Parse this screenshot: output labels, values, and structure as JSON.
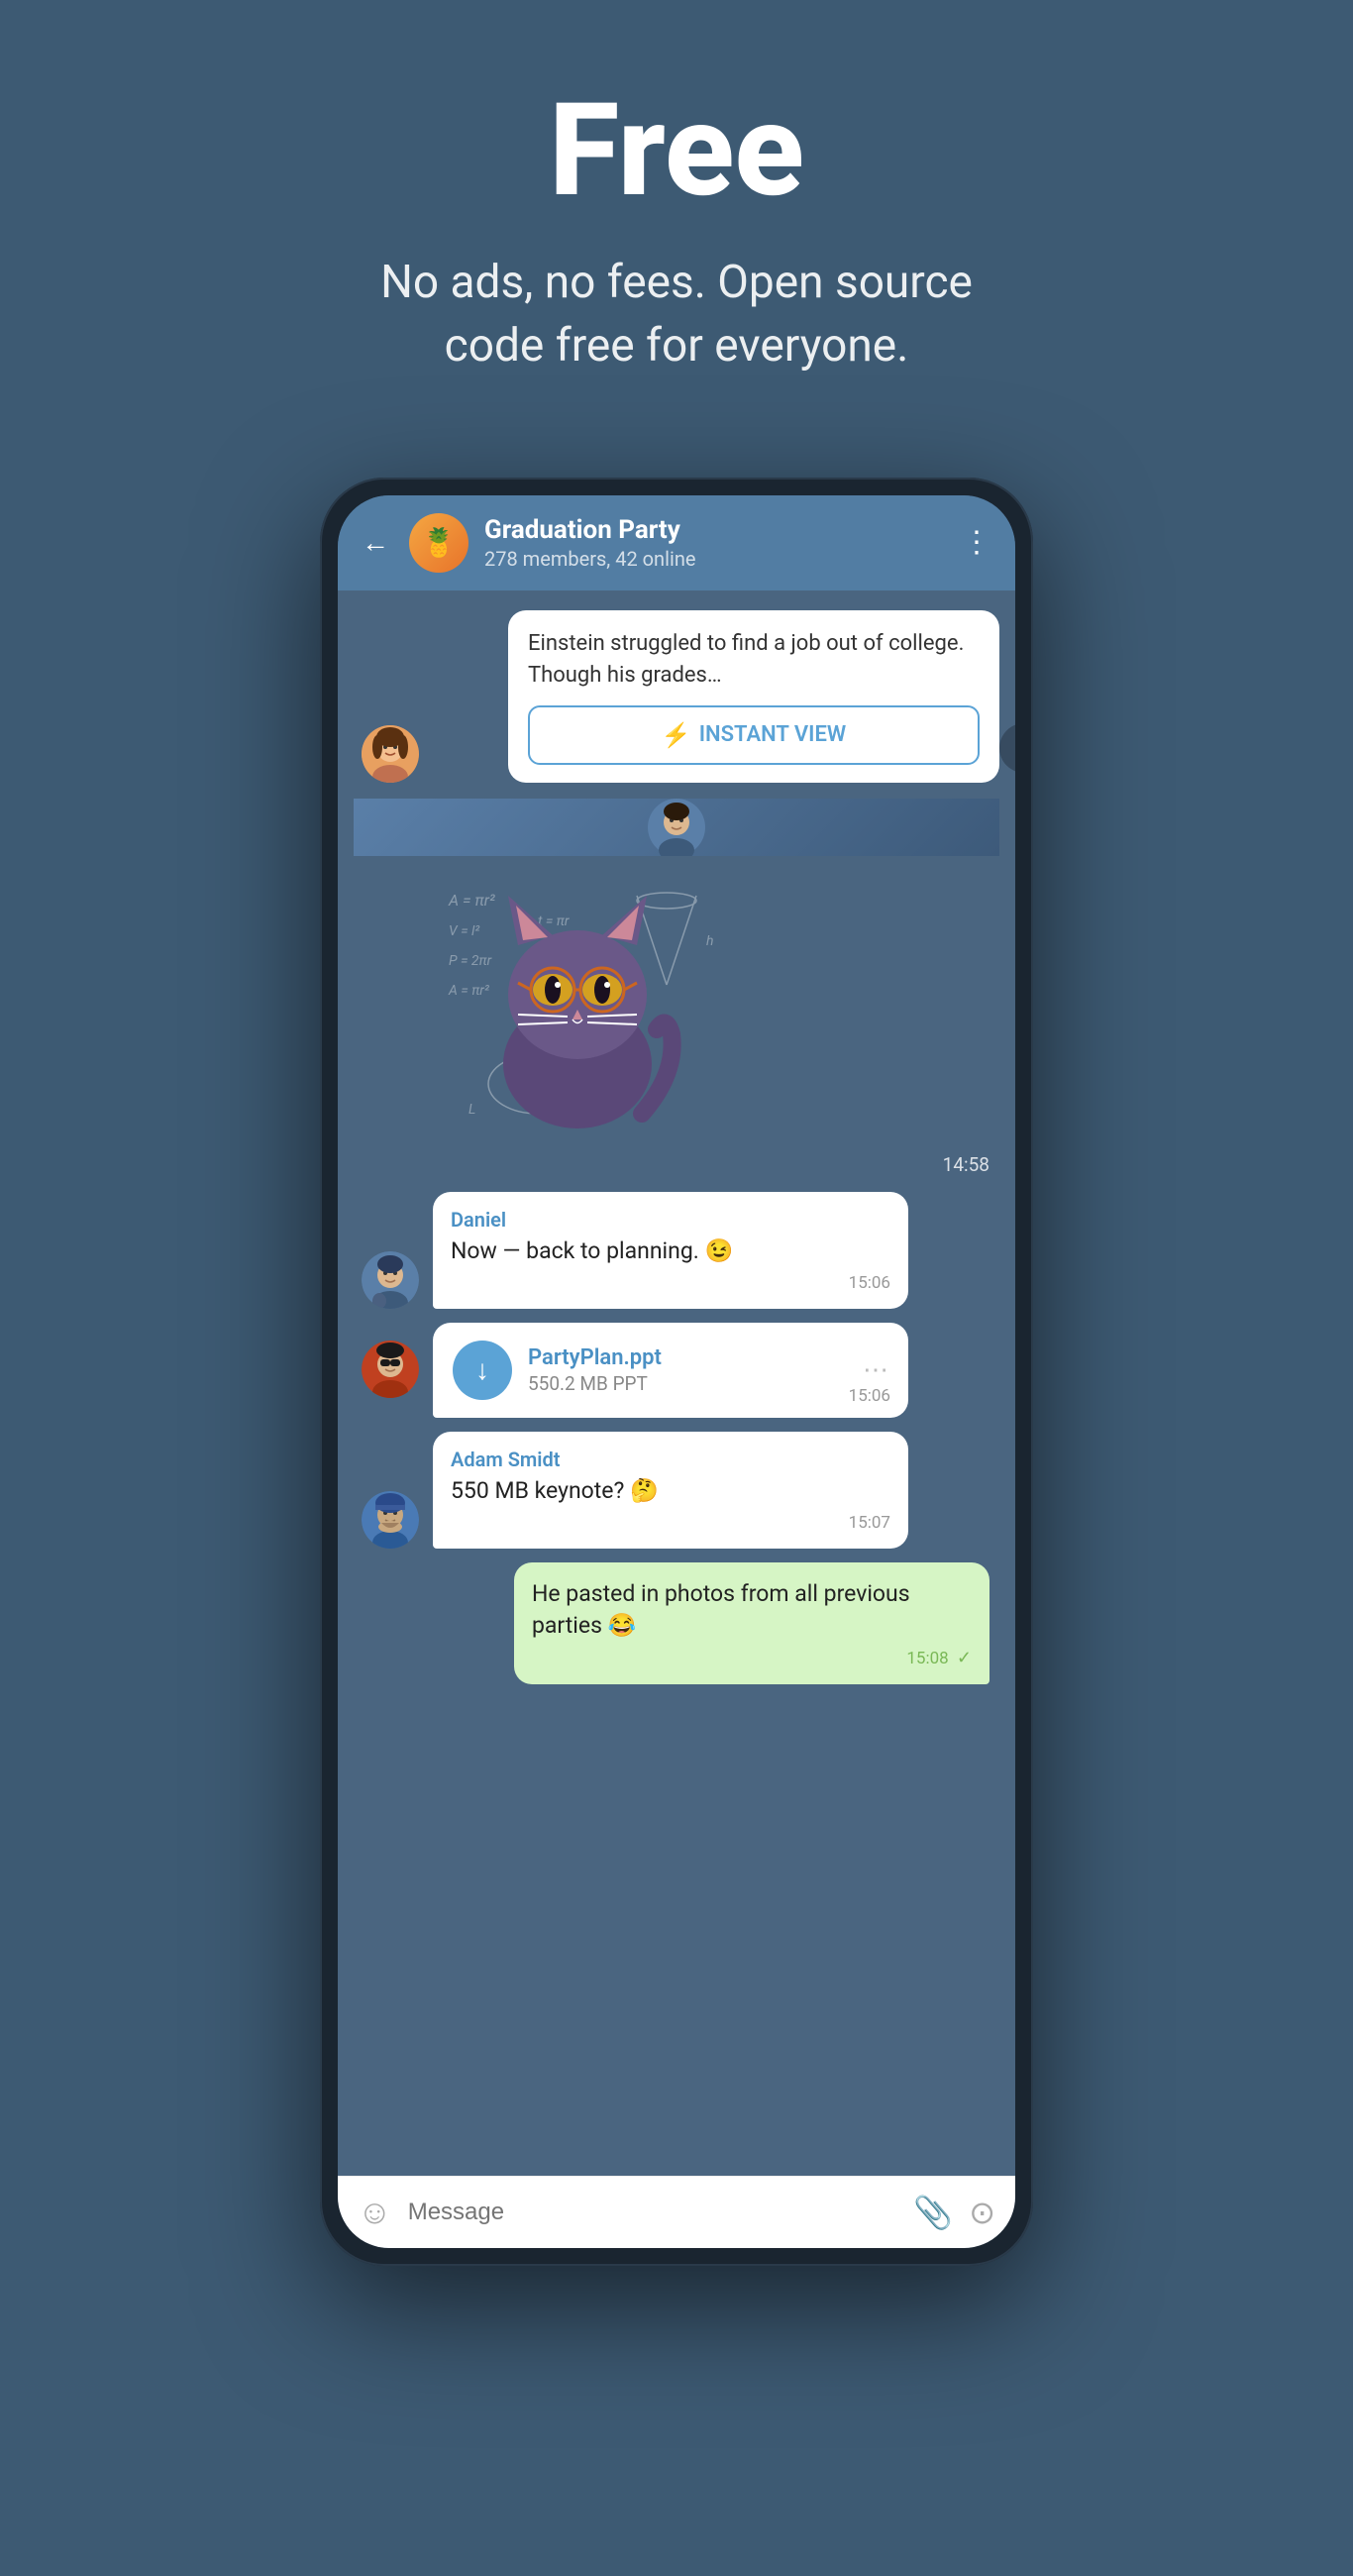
{
  "hero": {
    "title": "Free",
    "subtitle": "No ads, no fees. Open source code free for everyone."
  },
  "chat": {
    "back_label": "←",
    "group_avatar_emoji": "🍍",
    "group_name": "Graduation Party",
    "group_meta": "278 members, 42 online",
    "more_icon": "⋮",
    "article_text": "Einstein struggled to find a job out of college. Though his grades…",
    "instant_view_label": "INSTANT VIEW",
    "lightning": "⚡",
    "sticker_time": "14:58",
    "messages": [
      {
        "id": "msg1",
        "sender": "Daniel",
        "text": "Now — back to planning. 😉",
        "time": "15:06",
        "own": false,
        "avatar": "boy1"
      },
      {
        "id": "msg2_file",
        "file_name": "PartyPlan.ppt",
        "file_size": "550.2 MB PPT",
        "time": "15:06",
        "own": false,
        "avatar": "boy2"
      },
      {
        "id": "msg3",
        "sender": "Adam Smidt",
        "text": "550 MB keynote? 🤔",
        "time": "15:07",
        "own": false,
        "avatar": "adam"
      },
      {
        "id": "msg4",
        "text": "He pasted in photos from all previous parties 😂",
        "time": "15:08",
        "own": true,
        "checkmark": "✓"
      }
    ],
    "input_placeholder": "Message",
    "share_icon": "↪"
  }
}
